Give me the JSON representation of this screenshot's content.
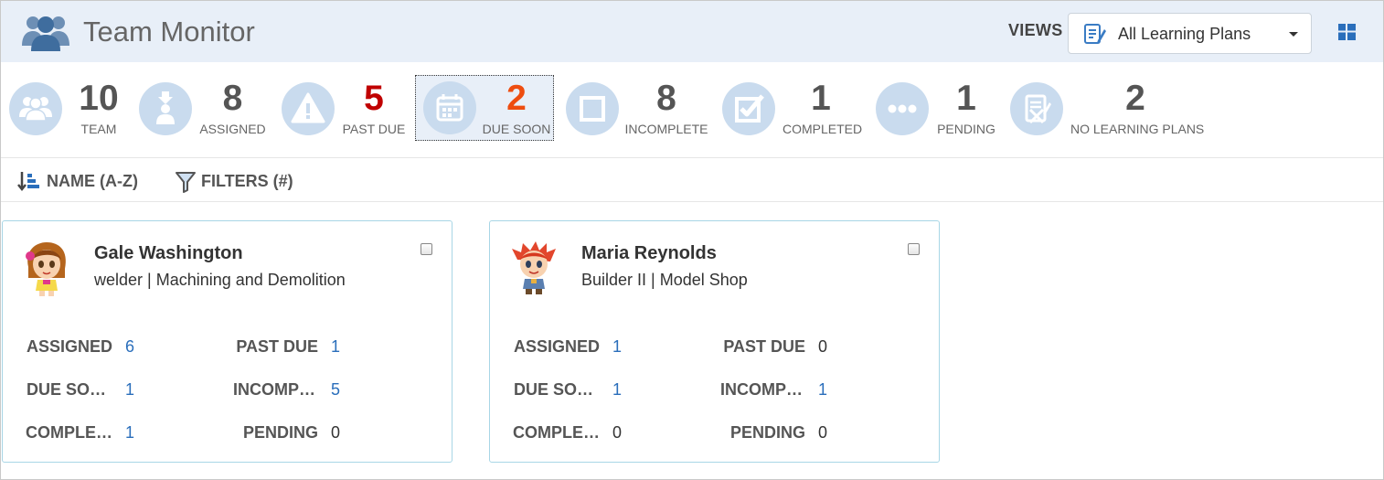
{
  "header": {
    "title": "Team Monitor",
    "views_label": "VIEWS",
    "views_selected": "All Learning Plans"
  },
  "stats": [
    {
      "key": "team",
      "value": "10",
      "label": "TEAM",
      "color": "#555555",
      "icon": "team-icon"
    },
    {
      "key": "assigned",
      "value": "8",
      "label": "ASSIGNED",
      "color": "#555555",
      "icon": "assigned-person-icon"
    },
    {
      "key": "past_due",
      "value": "5",
      "label": "PAST DUE",
      "color": "#c00000",
      "icon": "warning-icon"
    },
    {
      "key": "due_soon",
      "value": "2",
      "label": "DUE SOON",
      "color": "#ee4d10",
      "icon": "calendar-icon"
    },
    {
      "key": "incomplete",
      "value": "8",
      "label": "INCOMPLETE",
      "color": "#555555",
      "icon": "empty-square-icon"
    },
    {
      "key": "completed",
      "value": "1",
      "label": "COMPLETED",
      "color": "#555555",
      "icon": "checked-box-icon"
    },
    {
      "key": "pending",
      "value": "1",
      "label": "PENDING",
      "color": "#555555",
      "icon": "ellipsis-icon"
    },
    {
      "key": "no_plans",
      "value": "2",
      "label": "NO LEARNING PLANS",
      "color": "#555555",
      "icon": "crossed-document-icon"
    }
  ],
  "toolbar": {
    "sort_label": "NAME (A-Z)",
    "filter_label": "FILTERS (#)"
  },
  "cards": [
    {
      "name": "Gale Washington",
      "role": "welder | Machining and Demolition",
      "metrics": {
        "assigned_label": "ASSIGNED",
        "assigned": "6",
        "past_due_label": "PAST DUE",
        "past_due": "1",
        "due_soon_label": "DUE SO…",
        "due_soon": "1",
        "incomplete_label": "INCOMP…",
        "incomplete": "5",
        "completed_label": "COMPLE…",
        "completed": "1",
        "pending_label": "PENDING",
        "pending": "0"
      }
    },
    {
      "name": "Maria Reynolds",
      "role": "Builder II | Model Shop",
      "metrics": {
        "assigned_label": "ASSIGNED",
        "assigned": "1",
        "past_due_label": "PAST DUE",
        "past_due": "0",
        "due_soon_label": "DUE SO…",
        "due_soon": "1",
        "incomplete_label": "INCOMP…",
        "incomplete": "1",
        "completed_label": "COMPLE…",
        "completed": "0",
        "pending_label": "PENDING",
        "pending": "0"
      }
    }
  ],
  "colors": {
    "header_bg": "#e8eff8",
    "icon_circle": "#c9dbee",
    "link": "#2a6ebb",
    "card_border": "#a8d6e6"
  }
}
